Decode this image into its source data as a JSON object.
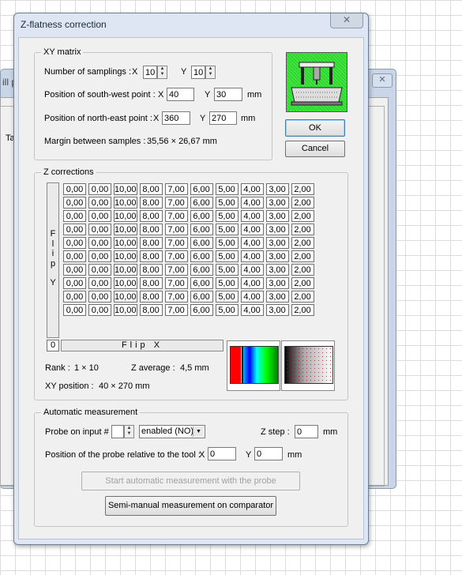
{
  "background_window": {
    "title_fragment": "ill p",
    "tab_fragment": "Ta",
    "close_label": "✕"
  },
  "dialog": {
    "title": "Z-flatness correction",
    "close_label": "✕"
  },
  "xy_matrix": {
    "legend": "XY matrix",
    "samplings_label": "Number of samplings :",
    "x_label": "X",
    "x_value": "10",
    "y_label": "Y",
    "y_value": "10",
    "sw_label": "Position of south-west point :",
    "sw_x_label": "X",
    "sw_x": "40",
    "sw_y_label": "Y",
    "sw_y": "30",
    "ne_label": "Position of north-east point :",
    "ne_x_label": "X",
    "ne_x": "360",
    "ne_y_label": "Y",
    "ne_y": "270",
    "unit": "mm",
    "margin_label": "Margin between samples :",
    "margin_value": "35,56 × 26,67 mm"
  },
  "buttons": {
    "ok": "OK",
    "cancel": "Cancel"
  },
  "z_corrections": {
    "legend": "Z corrections",
    "row_values": [
      "0,00",
      "0,00",
      "10,00",
      "8,00",
      "7,00",
      "6,00",
      "5,00",
      "4,00",
      "3,00",
      "2,00"
    ],
    "row_count": 10,
    "flip_y_letters": [
      "F",
      "l",
      "i",
      "p",
      "",
      "Y"
    ],
    "flip_x_label": "Flip X",
    "corner_value": "0",
    "rank_label": "Rank :",
    "rank_value": "1 × 10",
    "zavg_label": "Z average :",
    "zavg_value": "4,5 mm",
    "xypos_label": "XY position :",
    "xypos_value": "40 × 270 mm"
  },
  "auto": {
    "legend": "Automatic measurement",
    "probe_label": "Probe on input #",
    "probe_value": "",
    "probe_state": "enabled (NO)",
    "zstep_label": "Z step :",
    "zstep_value": "0",
    "unit": "mm",
    "relpos_label": "Position of the probe relative to the tool :",
    "rel_x_label": "X",
    "rel_x": "0",
    "rel_y_label": "Y",
    "rel_y": "0",
    "start_button": "Start automatic measurement with the probe",
    "semi_button": "Semi-manual measurement on comparator"
  },
  "colors": {
    "machine_icon_bg": "#3ee63e",
    "accent": "#3c7fb1"
  }
}
